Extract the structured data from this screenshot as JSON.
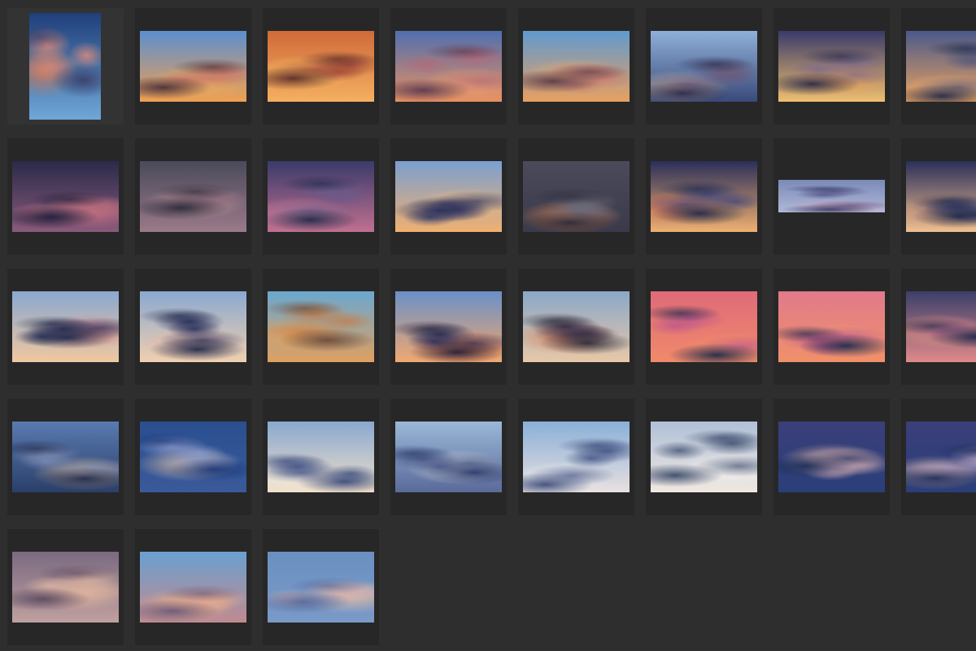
{
  "grid": {
    "background": "#2e2e2e",
    "cell_color": "#272727",
    "selected_cell_color": "#333333",
    "rows": [
      [
        {
          "orientation": "portrait",
          "sky_top": "#1f3f7a",
          "sky_bottom": "#6fa7d8",
          "glow": "#e07a4a",
          "cloud": "#d98a7a",
          "dark": "#3a3f6a",
          "selected": true
        },
        {
          "orientation": "landscape",
          "sky_top": "#5b8fd0",
          "sky_bottom": "#f0a050",
          "glow": "#f3b25a",
          "cloud": "#c97a6a",
          "dark": "#4a2f3a"
        },
        {
          "orientation": "landscape",
          "sky_top": "#d06a3a",
          "sky_bottom": "#f4b060",
          "glow": "#ffcc66",
          "cloud": "#a04a3a",
          "dark": "#5a2a2a"
        },
        {
          "orientation": "landscape",
          "sky_top": "#4f6fb0",
          "sky_bottom": "#e89060",
          "glow": "#f0a070",
          "cloud": "#b06a7a",
          "dark": "#5a3a50"
        },
        {
          "orientation": "landscape",
          "sky_top": "#5f9ad0",
          "sky_bottom": "#e8a060",
          "glow": "#f2b070",
          "cloud": "#c07a70",
          "dark": "#5a3a4a"
        },
        {
          "orientation": "landscape",
          "sky_top": "#8fb0d8",
          "sky_bottom": "#3a4a7a",
          "glow": "#e0c0a0",
          "cloud": "#6a5a7a",
          "dark": "#2a2a4a"
        },
        {
          "orientation": "landscape",
          "sky_top": "#3a3a6a",
          "sky_bottom": "#f0c070",
          "glow": "#f4a050",
          "cloud": "#7a6a8a",
          "dark": "#2a2a4a"
        },
        {
          "orientation": "landscape",
          "sky_top": "#4a5a8a",
          "sky_bottom": "#e8a060",
          "glow": "#f0b070",
          "cloud": "#5a5a7a",
          "dark": "#1f2a4a"
        }
      ],
      [
        {
          "orientation": "landscape",
          "sky_top": "#2a2a4a",
          "sky_bottom": "#8a5a7a",
          "glow": "#e07a8a",
          "cloud": "#b06a7a",
          "dark": "#1f1f3a"
        },
        {
          "orientation": "landscape",
          "sky_top": "#4a4a5a",
          "sky_bottom": "#9a7a8a",
          "glow": "#d0a0a0",
          "cloud": "#8a6a7a",
          "dark": "#2a2a3a"
        },
        {
          "orientation": "landscape",
          "sky_top": "#3a3a6a",
          "sky_bottom": "#c07090",
          "glow": "#e08aa0",
          "cloud": "#6a5a8a",
          "dark": "#1f2a4a"
        },
        {
          "orientation": "landscape",
          "sky_top": "#7aa0d0",
          "sky_bottom": "#f0b070",
          "glow": "#f4c080",
          "cloud": "#3a3f6a",
          "dark": "#2a2f5a"
        },
        {
          "orientation": "landscape",
          "sky_top": "#4a4a5a",
          "sky_bottom": "#3a3a4a",
          "glow": "#f08a50",
          "cloud": "#6a6a7a",
          "dark": "#2a2a3a"
        },
        {
          "orientation": "landscape",
          "sky_top": "#2a2f5a",
          "sky_bottom": "#f0b070",
          "glow": "#f07a50",
          "cloud": "#4a4a7a",
          "dark": "#1f2a4a"
        },
        {
          "orientation": "wide",
          "sky_top": "#7a8ab8",
          "sky_bottom": "#b0b8d8",
          "glow": "#e0a0b0",
          "cloud": "#5a5a8a",
          "dark": "#3a3f6a"
        },
        {
          "orientation": "landscape",
          "sky_top": "#2a2f5a",
          "sky_bottom": "#f0c090",
          "glow": "#e0a080",
          "cloud": "#3a3f6a",
          "dark": "#1f2a4a"
        }
      ],
      [
        {
          "orientation": "landscape",
          "sky_top": "#8aa8d0",
          "sky_bottom": "#f0c8a0",
          "glow": "#e07a7a",
          "cloud": "#2a2f5a",
          "dark": "#1f2a4a"
        },
        {
          "orientation": "landscape",
          "sky_top": "#8aa8d0",
          "sky_bottom": "#f0d0b0",
          "glow": "#e8b0a0",
          "cloud": "#2a2f5a",
          "dark": "#1f2a4a"
        },
        {
          "orientation": "landscape",
          "sky_top": "#6aa8d0",
          "sky_bottom": "#e0a060",
          "glow": "#f0a050",
          "cloud": "#c08050",
          "dark": "#6a4a3a"
        },
        {
          "orientation": "landscape",
          "sky_top": "#6a90c8",
          "sky_bottom": "#f0a870",
          "glow": "#f0703a",
          "cloud": "#2a2f5a",
          "dark": "#1f1f3a"
        },
        {
          "orientation": "landscape",
          "sky_top": "#8aa8c8",
          "sky_bottom": "#e8c8a8",
          "glow": "#e07a4a",
          "cloud": "#3a2f4a",
          "dark": "#2a2a3a"
        },
        {
          "orientation": "landscape",
          "sky_top": "#e06a7a",
          "sky_bottom": "#f08a6a",
          "glow": "#f0906a",
          "cloud": "#c05a8a",
          "dark": "#1f2a4a"
        },
        {
          "orientation": "landscape",
          "sky_top": "#e07a8a",
          "sky_bottom": "#f0906a",
          "glow": "#f0a080",
          "cloud": "#c05a8a",
          "dark": "#1f2a4a"
        },
        {
          "orientation": "landscape",
          "sky_top": "#3a3f6a",
          "sky_bottom": "#e08a8a",
          "glow": "#f0a080",
          "cloud": "#b06a8a",
          "dark": "#1f2a4a"
        }
      ],
      [
        {
          "orientation": "landscape",
          "sky_top": "#5a7ab0",
          "sky_bottom": "#2a3f6a",
          "glow": "#f0c8a0",
          "cloud": "#7a8ab0",
          "dark": "#1f2a4a"
        },
        {
          "orientation": "landscape",
          "sky_top": "#2a4f90",
          "sky_bottom": "#3a5a9a",
          "glow": "#f0c8a0",
          "cloud": "#8a9ac8",
          "dark": "#1f3a7a"
        },
        {
          "orientation": "landscape",
          "sky_top": "#8aa8d0",
          "sky_bottom": "#f0e0c8",
          "glow": "#f8f0e0",
          "cloud": "#4a5a8a",
          "dark": "#3a4a7a"
        },
        {
          "orientation": "landscape",
          "sky_top": "#9ab8d8",
          "sky_bottom": "#5a6a9a",
          "glow": "#f0e8e0",
          "cloud": "#4a5a8a",
          "dark": "#2a3a6a"
        },
        {
          "orientation": "landscape",
          "sky_top": "#8ab0d8",
          "sky_bottom": "#e8e0e0",
          "glow": "#f0f0f0",
          "cloud": "#4a5a8a",
          "dark": "#3a4a7a"
        },
        {
          "orientation": "landscape",
          "sky_top": "#b0c0d8",
          "sky_bottom": "#f0e8e0",
          "glow": "#f8f4f0",
          "cloud": "#4a5a7a",
          "dark": "#3a4a6a"
        },
        {
          "orientation": "landscape",
          "sky_top": "#3a3f7a",
          "sky_bottom": "#2a3f7a",
          "glow": "#f0c0a0",
          "cloud": "#c0a0b0",
          "dark": "#1f2f5a"
        },
        {
          "orientation": "landscape",
          "sky_top": "#3a3f7a",
          "sky_bottom": "#2a3f7a",
          "glow": "#f0c0b0",
          "cloud": "#b0a0c0",
          "dark": "#1f2f5a"
        }
      ],
      [
        {
          "orientation": "landscape",
          "sky_top": "#7a6a80",
          "sky_bottom": "#c0a0a0",
          "glow": "#f0c0a0",
          "cloud": "#d8b0a0",
          "dark": "#5a4a60"
        },
        {
          "orientation": "landscape",
          "sky_top": "#6aa0d0",
          "sky_bottom": "#c08a90",
          "glow": "#f0b080",
          "cloud": "#e0a890",
          "dark": "#6a5a7a"
        },
        {
          "orientation": "landscape",
          "sky_top": "#6a90c0",
          "sky_bottom": "#7a9ac8",
          "glow": "#f0c0a0",
          "cloud": "#d0b0b0",
          "dark": "#5a6a9a"
        }
      ]
    ]
  }
}
